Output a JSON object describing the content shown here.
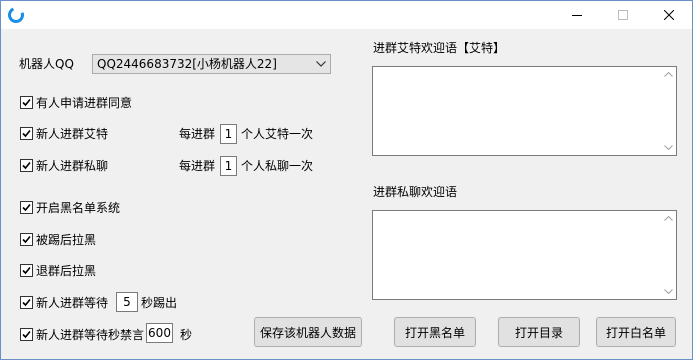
{
  "window": {
    "controls": {
      "minimize": "minimize",
      "maximize": "maximize",
      "close": "close"
    }
  },
  "robot": {
    "label": "机器人QQ",
    "selected": "QQ2446683732[小杨机器人22]"
  },
  "options": {
    "join_approve": {
      "label": "有人申请进群同意",
      "checked": true
    },
    "join_at": {
      "label": "新人进群艾特",
      "checked": true,
      "every_prefix": "每进群",
      "every_value": "1",
      "every_suffix": "个人艾特一次"
    },
    "join_pm": {
      "label": "新人进群私聊",
      "checked": true,
      "every_prefix": "每进群",
      "every_value": "1",
      "every_suffix": "个人私聊一次"
    },
    "blacklist": {
      "label": "开启黑名单系统",
      "checked": true
    },
    "kicked_black": {
      "label": "被踢后拉黑",
      "checked": true
    },
    "quit_black": {
      "label": "退群后拉黑",
      "checked": true
    },
    "wait_kick": {
      "label": "新人进群等待",
      "checked": true,
      "value": "5",
      "suffix": "秒踢出"
    },
    "wait_mute": {
      "label": "新人进群等待秒禁言",
      "checked": true,
      "value": "600",
      "suffix": "秒"
    }
  },
  "welcome_at": {
    "label": "进群艾特欢迎语【艾特】",
    "value": ""
  },
  "welcome_pm": {
    "label": "进群私聊欢迎语",
    "value": ""
  },
  "buttons": {
    "save": "保存该机器人数据",
    "blacklist": "打开黑名单",
    "directory": "打开目录",
    "whitelist": "打开白名单"
  }
}
